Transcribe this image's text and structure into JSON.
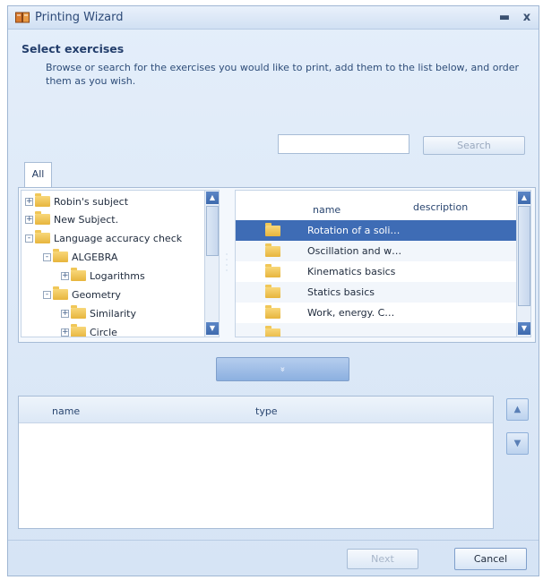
{
  "window": {
    "title": "Printing Wizard",
    "minimize_glyph": "▬",
    "close_glyph": "x"
  },
  "section": {
    "heading": "Select exercises",
    "description": "Browse or search for the exercises you would like to print, add them to the list below, and order them as you wish."
  },
  "search": {
    "value": "",
    "placeholder": "",
    "button_label": "Search"
  },
  "tabs": [
    {
      "label": "All",
      "selected": true
    }
  ],
  "tree": {
    "items": [
      {
        "label": "Robin's subject",
        "expander": "+",
        "level": 0
      },
      {
        "label": "New Subject.",
        "expander": "+",
        "level": 0
      },
      {
        "label": "Language accuracy check",
        "expander": "-",
        "level": 0
      },
      {
        "label": "ALGEBRA",
        "expander": "-",
        "level": 1
      },
      {
        "label": "Logarithms",
        "expander": "+",
        "level": 2
      },
      {
        "label": "Geometry",
        "expander": "-",
        "level": 1
      },
      {
        "label": "Similarity",
        "expander": "+",
        "level": 2
      },
      {
        "label": "Circle",
        "expander": "+",
        "level": 2
      }
    ]
  },
  "exercise_list": {
    "columns": [
      "name",
      "description"
    ],
    "rows": [
      {
        "name": "Rotation of a soli…",
        "description": "",
        "selected": true
      },
      {
        "name": "Oscillation and w…",
        "description": "",
        "selected": false
      },
      {
        "name": "Kinematics basics",
        "description": "",
        "selected": false
      },
      {
        "name": "Statics basics",
        "description": "",
        "selected": false
      },
      {
        "name": "Work, energy. C…",
        "description": "",
        "selected": false
      }
    ]
  },
  "add_button": {
    "label": "»",
    "icon": "double-chevron-down-icon"
  },
  "selected_list": {
    "columns": [
      "name",
      "type"
    ],
    "rows": []
  },
  "order_buttons": {
    "up_glyph": "▲",
    "down_glyph": "▼"
  },
  "footer": {
    "next_label": "Next",
    "cancel_label": "Cancel"
  },
  "colors": {
    "accent": "#3e6cb5",
    "window_bg": "#dce8f6",
    "folder": "#e7b53d"
  }
}
